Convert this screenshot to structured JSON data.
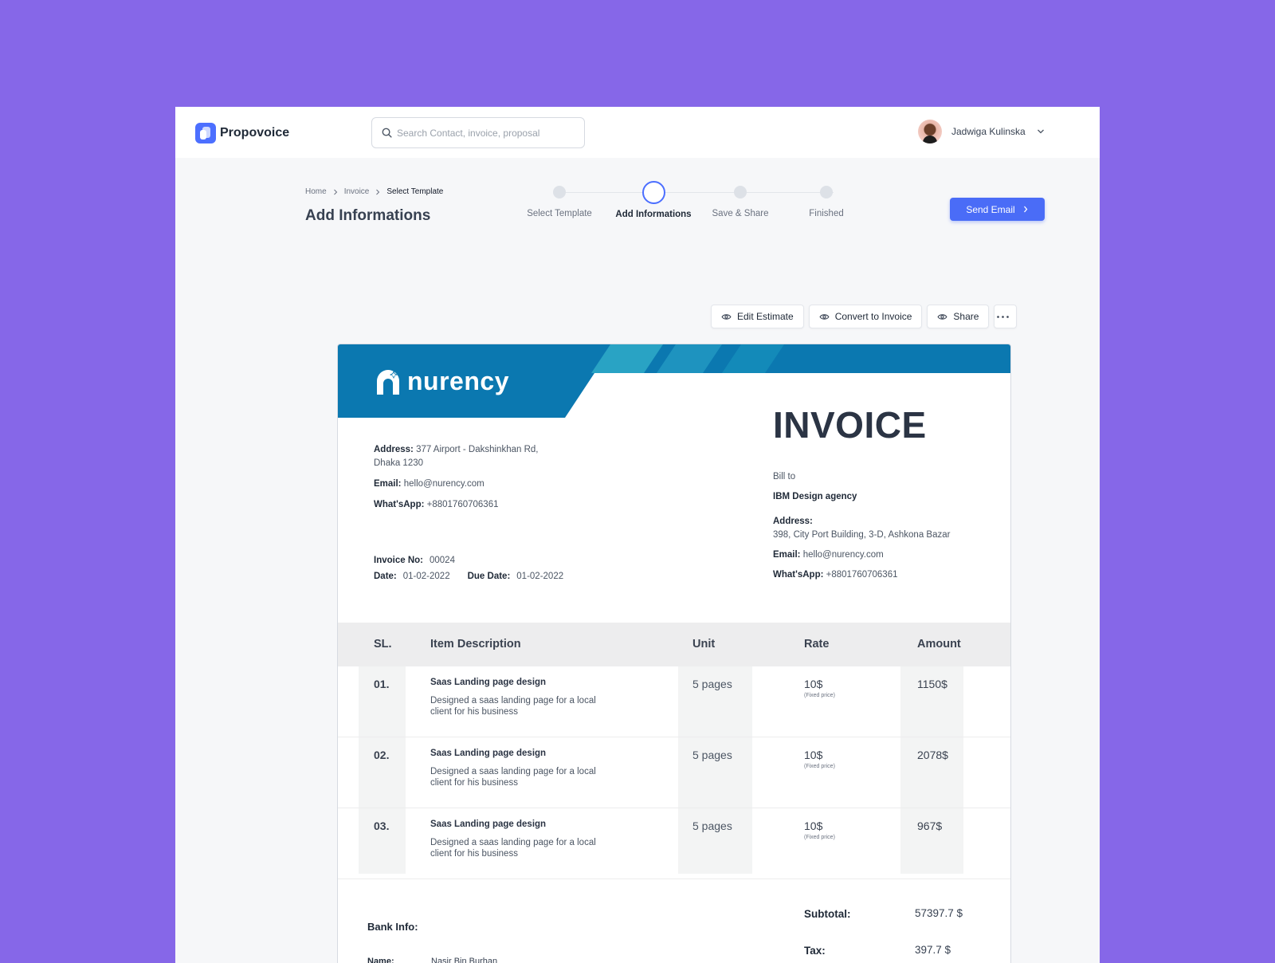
{
  "app": {
    "name": "Propovoice"
  },
  "search": {
    "placeholder": "Search Contact, invoice, proposal"
  },
  "user": {
    "name": "Jadwiga Kulinska"
  },
  "breadcrumb": [
    "Home",
    "Invoice",
    "Select Template"
  ],
  "page_title": "Add Informations",
  "steps": [
    {
      "label": "Select Template",
      "active": false
    },
    {
      "label": "Add Informations",
      "active": true
    },
    {
      "label": "Save & Share",
      "active": false
    },
    {
      "label": "Finished",
      "active": false
    }
  ],
  "send_email_label": "Send Email",
  "actions": {
    "edit": "Edit Estimate",
    "convert": "Convert to Invoice",
    "share": "Share"
  },
  "invoice": {
    "brand": "nurency",
    "title": "INVOICE",
    "colors": {
      "brand_blue": "#0b78b0",
      "brand_teal": "#29a3c4",
      "accent": "#4a6cf7"
    },
    "from": {
      "address_label": "Address:",
      "address_line1": "377 Airport - Dakshinkhan Rd,",
      "address_line2": "Dhaka 1230",
      "email_label": "Email:",
      "email": "hello@nurency.com",
      "whatsapp_label": "What'sApp:",
      "whatsapp": "+8801760706361"
    },
    "meta": {
      "invoice_no_label": "Invoice No:",
      "invoice_no": "00024",
      "date_label": "Date:",
      "date": "01-02-2022",
      "due_label": "Due Date:",
      "due": "01-02-2022"
    },
    "bill_to": {
      "heading": "Bill to",
      "company": "IBM Design agency",
      "address_label": "Address:",
      "address": "398, City Port Building, 3-D, Ashkona Bazar",
      "email_label": "Email:",
      "email": "hello@nurency.com",
      "whatsapp_label": "What'sApp:",
      "whatsapp": "+8801760706361"
    },
    "columns": {
      "sl": "SL.",
      "desc": "Item Description",
      "unit": "Unit",
      "rate": "Rate",
      "amount": "Amount"
    },
    "items": [
      {
        "sl": "01.",
        "title": "Saas Landing page design",
        "desc": "Designed a saas landing page for a local client for his business",
        "unit": "5 pages",
        "rate": "10$",
        "rate_note": "(Fixed price)",
        "amount": "1150$"
      },
      {
        "sl": "02.",
        "title": "Saas Landing page design",
        "desc": "Designed a saas landing page for a local client for his business",
        "unit": "5 pages",
        "rate": "10$",
        "rate_note": "(Fixed price)",
        "amount": "2078$"
      },
      {
        "sl": "03.",
        "title": "Saas Landing page design",
        "desc": "Designed a saas landing page for a local client for his business",
        "unit": "5 pages",
        "rate": "10$",
        "rate_note": "(Fixed price)",
        "amount": "967$"
      }
    ],
    "bank": {
      "heading": "Bank Info:",
      "name_label": "Name:",
      "name": "Nasir Bin Burhan"
    },
    "totals": {
      "subtotal_label": "Subtotal:",
      "subtotal": "57397.7 $",
      "tax_label": "Tax:",
      "tax": "397.7 $"
    }
  }
}
